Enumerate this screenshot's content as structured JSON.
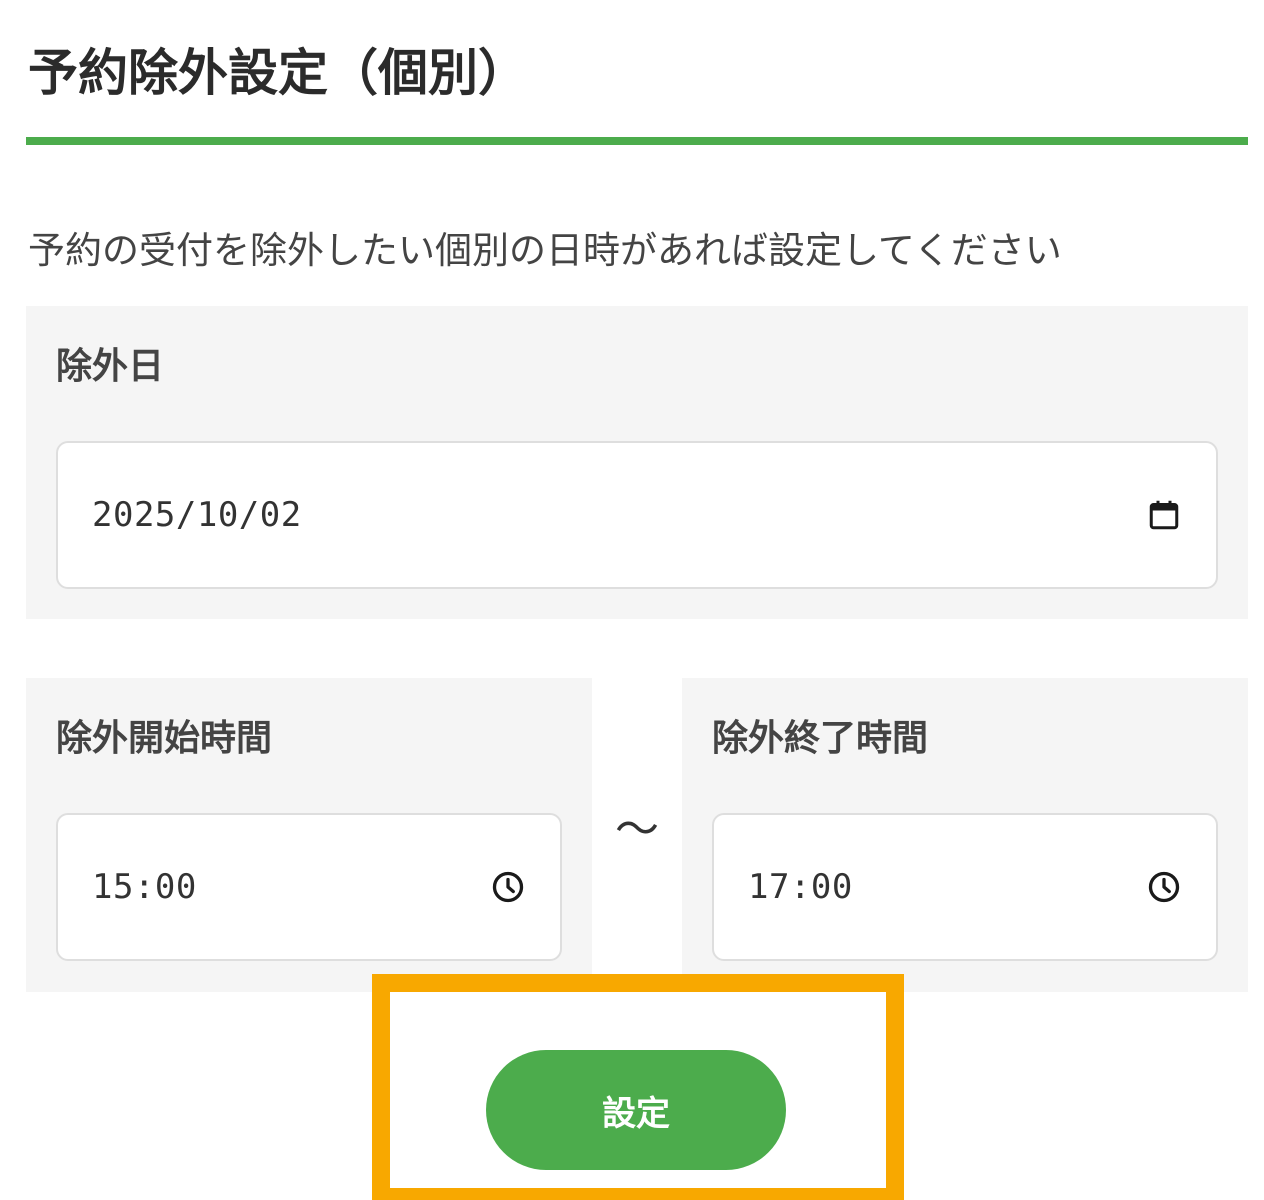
{
  "page": {
    "title": "予約除外設定（個別）",
    "description": "予約の受付を除外したい個別の日時があれば設定してください"
  },
  "exclusion_date": {
    "label": "除外日",
    "value": "2025/10/02",
    "icon": "calendar-icon"
  },
  "start_time": {
    "label": "除外開始時間",
    "value": "15:00",
    "icon": "clock-icon"
  },
  "range_separator": "〜",
  "end_time": {
    "label": "除外終了時間",
    "value": "17:00",
    "icon": "clock-icon"
  },
  "actions": {
    "save_label": "設定"
  },
  "colors": {
    "accent_green": "#4cac4c",
    "highlight_orange": "#f8a800",
    "panel_bg": "#f5f5f5"
  }
}
